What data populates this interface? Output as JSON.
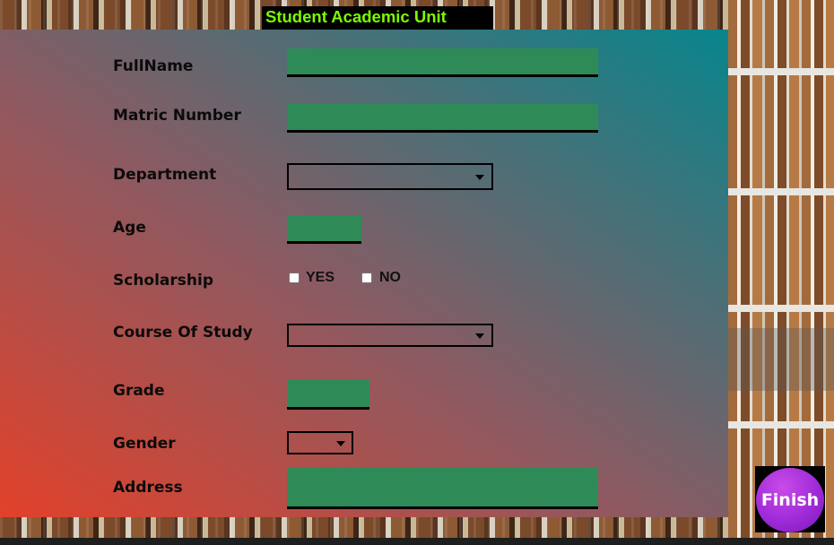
{
  "title": "Student Academic Unit",
  "labels": {
    "fullname": "FullName",
    "matric": "Matric Number",
    "department": "Department",
    "age": "Age",
    "scholarship": "Scholarship",
    "course": "Course Of Study",
    "grade": "Grade",
    "gender": "Gender",
    "address": "Address"
  },
  "fields": {
    "fullname": "",
    "matric": "",
    "department": "",
    "age": "",
    "course": "",
    "grade": "",
    "gender": "",
    "address": ""
  },
  "scholarship_options": {
    "yes": "YES",
    "no": "NO"
  },
  "finish_label": "Finish",
  "colors": {
    "title_text": "#7cfc00",
    "field_fill": "#2e8b57",
    "finish_button": "#9f2bd8",
    "panel_gradient_start": "#e2412a",
    "panel_gradient_end": "#08858c"
  }
}
